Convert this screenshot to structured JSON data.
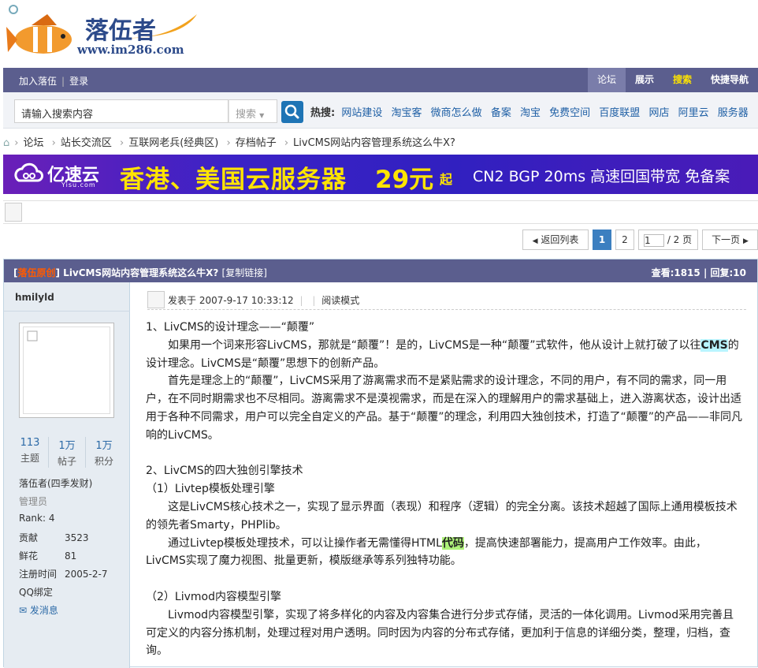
{
  "logo": {
    "brand": "落伍者",
    "url": "www.im286.com"
  },
  "topbar": {
    "join": "加入落伍",
    "login": "登录",
    "tabs": [
      "论坛",
      "展示",
      "搜索",
      "快捷导航"
    ]
  },
  "search": {
    "placeholder": "请输入搜索内容",
    "select_label": "搜索",
    "hot_label": "热搜:",
    "hot_links": [
      "网站建设",
      "淘宝客",
      "微商怎么做",
      "备案",
      "淘宝",
      "免费空间",
      "百度联盟",
      "网店",
      "阿里云",
      "服务器"
    ]
  },
  "breadcrumb": [
    "论坛",
    "站长交流区",
    "互联网老兵(经典区)",
    "存档帖子",
    "LivCMS网站内容管理系统这么牛X?"
  ],
  "banner": {
    "brand": "亿速云",
    "brand_sub": "Yisu.com",
    "headline": "香港、美国云服务器",
    "price": "29元",
    "price_suffix": "起",
    "sub": "CN2 BGP 20ms 高速回国带宽 免备案"
  },
  "pagination": {
    "back": "返回列表",
    "current": "1",
    "page2": "2",
    "input_value": "1",
    "total": "/ 2 页",
    "next": "下一页"
  },
  "post": {
    "tag": "落伍原创",
    "title": "LivCMS网站内容管理系统这么牛X?",
    "copy_link": "[复制链接]",
    "stats": "查看:1815 | 回复:10",
    "author": {
      "name": "hmilyld",
      "stats": [
        {
          "n": "113",
          "label": "主题"
        },
        {
          "n": "1万",
          "label": "帖子"
        },
        {
          "n": "1万",
          "label": "积分"
        }
      ],
      "group": "落伍者(四季发财)",
      "role": "管理员",
      "rank": "Rank: 4",
      "gongxian_k": "贡献",
      "gongxian_v": "3523",
      "xianhua_k": "鲜花",
      "xianhua_v": "81",
      "reg_k": "注册时间",
      "reg_v": "2005-2-7",
      "qq": "QQ绑定",
      "message": "发消息"
    },
    "meta": {
      "posted": "发表于 2007-9-17 10:33:12",
      "sep": "|",
      "read_mode": "阅读模式"
    },
    "content": {
      "h1": "1、LivCMS的设计理念——“颠覆”",
      "p1a": "如果用一个词来形容LivCMS，那就是“颠覆”！是的，LivCMS是一种“颠覆”式软件，他从设计上就打破了以往",
      "p1_hl": "CMS",
      "p1b": "的设计理念。LivCMS是“颠覆”思想下的创新产品。",
      "p2": "首先是理念上的“颠覆”，LivCMS采用了游离需求而不是紧贴需求的设计理念，不同的用户，有不同的需求，同一用户，在不同时期需求也不尽相同。游离需求不是漠视需求，而是在深入的理解用户的需求基础上，进入游离状态，设计出适用于各种不同需求，用户可以完全自定义的产品。基于“颠覆”的理念，利用四大独创技术，打造了“颠覆”的产品——非同凡响的LivCMS。",
      "h2": "2、LivCMS的四大独创引擎技术",
      "h2a": "（1）Livtep模板处理引擎",
      "p3": "这是LivCMS核心技术之一，实现了显示界面（表现）和程序（逻辑）的完全分离。该技术超越了国际上通用模板技术的领先者Smarty，PHPlib。",
      "p4a": "通过Livtep模板处理技术，可以让操作者无需懂得HTML",
      "p4_hl": "代码",
      "p4b": "，提高快速部署能力，提高用户工作效率。由此，LivCMS实现了魔力视图、批量更新，模版继承等系列独特功能。",
      "h2b": "（2）Livmod内容模型引擎",
      "p5": "Livmod内容模型引擎，实现了将多样化的内容及内容集合进行分步式存储，灵活的一体化调用。Livmod采用完善且可定义的内容分拣机制，处理过程对用户透明。同时因为内容的分布式存储，更加利于信息的详细分类，整理，归档，查询。"
    }
  },
  "colors": {
    "nav": "#5b5e8e",
    "link": "#1e5fa5",
    "tag": "#ff5a00",
    "banner_yellow": "#ffe400"
  }
}
